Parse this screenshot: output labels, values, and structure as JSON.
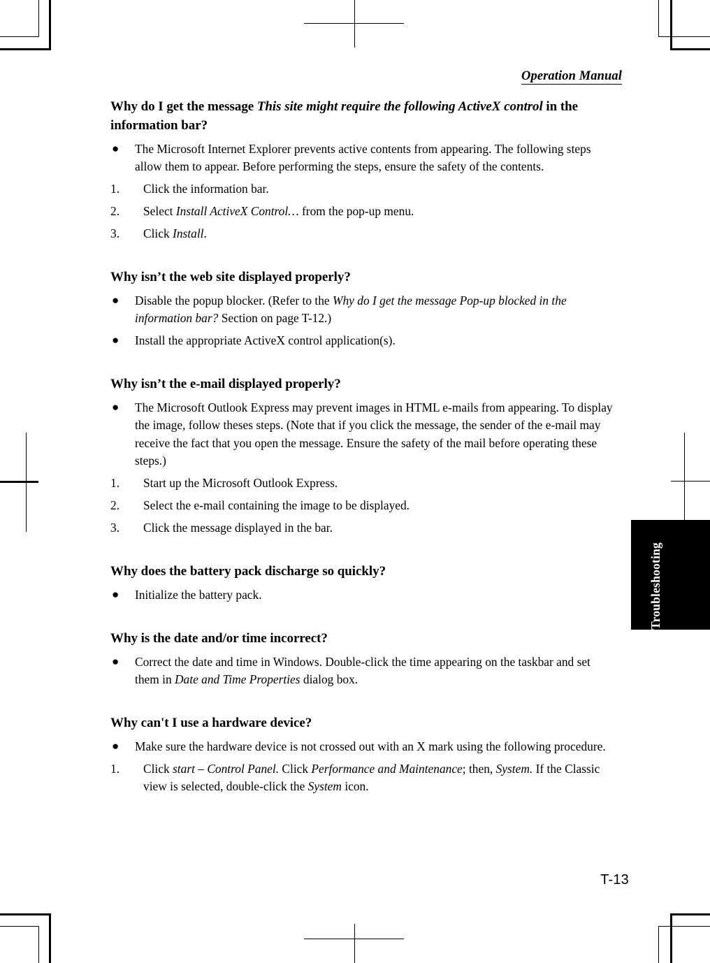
{
  "header": {
    "running_head": "Operation Manual"
  },
  "tab": {
    "label": "Troubleshooting"
  },
  "folio": {
    "page_number": "T-13"
  },
  "sections": [
    {
      "heading_parts": [
        {
          "text": "Why do I get the message ",
          "italic": false
        },
        {
          "text": "This site might require the following ActiveX control",
          "italic": true
        },
        {
          "text": " in the information bar?",
          "italic": false
        }
      ],
      "bullets": [
        "The Microsoft Internet Explorer prevents active contents from appearing. The following steps allow them to appear. Before performing the steps, ensure the safety of the contents."
      ],
      "steps": [
        {
          "num": "1.",
          "parts": [
            {
              "text": "Click the information bar.",
              "italic": false
            }
          ]
        },
        {
          "num": "2.",
          "parts": [
            {
              "text": "Select ",
              "italic": false
            },
            {
              "text": "Install ActiveX Control…",
              "italic": true
            },
            {
              "text": " from the pop-up menu.",
              "italic": false
            }
          ]
        },
        {
          "num": "3.",
          "parts": [
            {
              "text": "Click ",
              "italic": false
            },
            {
              "text": "Install",
              "italic": true
            },
            {
              "text": ".",
              "italic": false
            }
          ]
        }
      ]
    },
    {
      "heading_parts": [
        {
          "text": "Why isn’t the web site displayed properly?",
          "italic": false
        }
      ],
      "bullet_parts": [
        [
          {
            "text": "Disable the popup blocker. (Refer to the ",
            "italic": false
          },
          {
            "text": "Why do I get the message Pop-up blocked in the information bar?",
            "italic": true
          },
          {
            "text": " Section on page T-12.)",
            "italic": false
          }
        ],
        [
          {
            "text": "Install the appropriate ActiveX control application(s).",
            "italic": false
          }
        ]
      ]
    },
    {
      "heading_parts": [
        {
          "text": "Why isn’t the e-mail displayed properly?",
          "italic": false
        }
      ],
      "bullets": [
        "The Microsoft Outlook Express may prevent images in HTML e-mails from appearing. To display the image, follow theses steps. (Note that if you click the message, the sender of the e-mail may receive the fact that you open the message. Ensure the safety of the mail before operating these steps.)"
      ],
      "steps": [
        {
          "num": "1.",
          "parts": [
            {
              "text": "Start up the Microsoft Outlook Express.",
              "italic": false
            }
          ]
        },
        {
          "num": "2.",
          "parts": [
            {
              "text": "Select the e-mail containing the image to be displayed.",
              "italic": false
            }
          ]
        },
        {
          "num": "3.",
          "parts": [
            {
              "text": "Click the message displayed in the bar.",
              "italic": false
            }
          ]
        }
      ]
    },
    {
      "heading_parts": [
        {
          "text": "Why does the battery pack discharge so quickly?",
          "italic": false
        }
      ],
      "bullet_parts": [
        [
          {
            "text": "Initialize the battery pack.",
            "italic": false
          }
        ]
      ]
    },
    {
      "heading_parts": [
        {
          "text": "Why is the date and/or time incorrect?",
          "italic": false
        }
      ],
      "bullet_parts": [
        [
          {
            "text": "Correct the date and time in Windows. Double-click the time appearing on the taskbar and set them in ",
            "italic": false
          },
          {
            "text": "Date and Time Properties",
            "italic": true
          },
          {
            "text": " dialog box.",
            "italic": false
          }
        ]
      ]
    },
    {
      "heading_parts": [
        {
          "text": "Why can't I use a hardware device?",
          "italic": false
        }
      ],
      "bullet_parts": [
        [
          {
            "text": "Make sure the hardware device is not crossed out with an X mark using the following procedure.",
            "italic": false
          }
        ]
      ],
      "steps": [
        {
          "num": "1.",
          "parts": [
            {
              "text": "Click ",
              "italic": false
            },
            {
              "text": "start – Control Panel.",
              "italic": true
            },
            {
              "text": " Click ",
              "italic": false
            },
            {
              "text": "Performance and Maintenance",
              "italic": true
            },
            {
              "text": "; then, ",
              "italic": false
            },
            {
              "text": "System.",
              "italic": true
            },
            {
              "text": " If the Classic view is selected, double-click the ",
              "italic": false
            },
            {
              "text": "System",
              "italic": true
            },
            {
              "text": " icon.",
              "italic": false
            }
          ]
        }
      ]
    }
  ],
  "bullet_glyph": "●"
}
